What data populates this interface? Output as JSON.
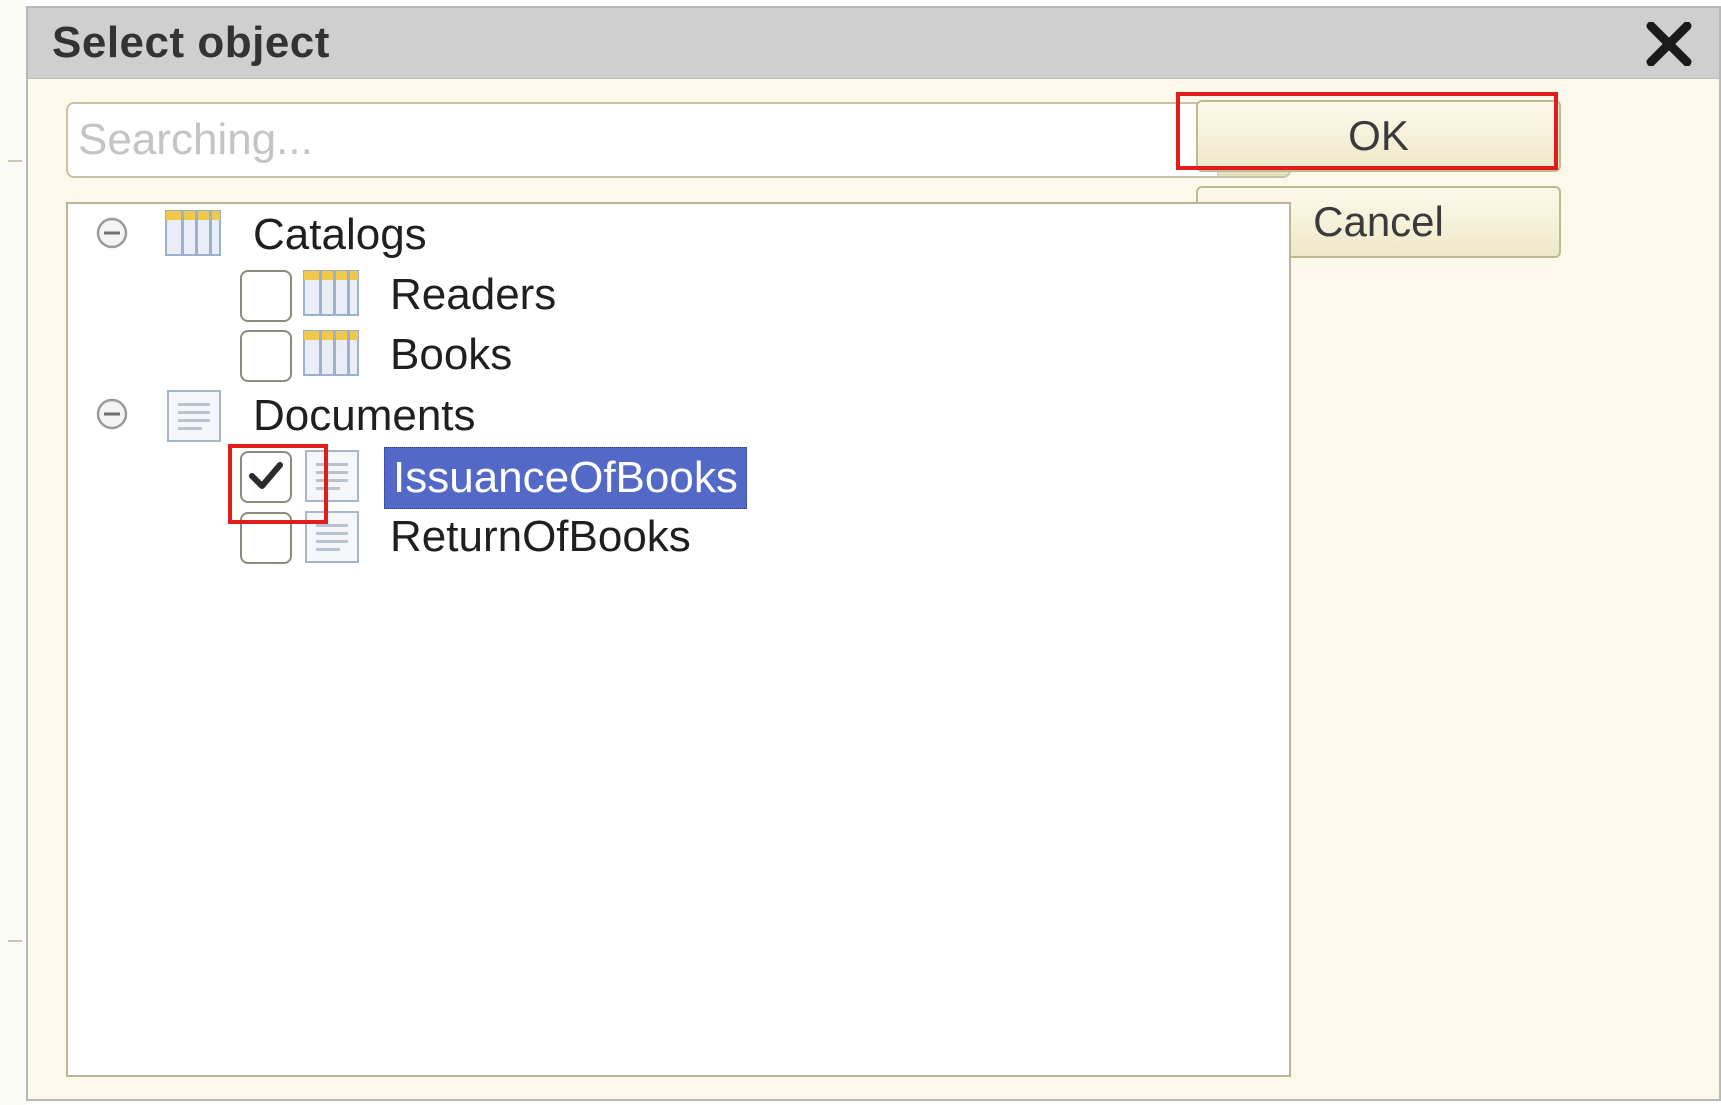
{
  "dialog": {
    "title": "Select object",
    "close_icon": "close-icon"
  },
  "search": {
    "value": "",
    "placeholder": "Searching...",
    "clear_icon": "clear-icon"
  },
  "buttons": {
    "ok_label": "OK",
    "cancel_label": "Cancel"
  },
  "tree": {
    "groups": [
      {
        "label": "Catalogs",
        "icon": "catalog-icon",
        "expanded": true,
        "items": [
          {
            "label": "Readers",
            "icon": "catalog-icon",
            "checked": false,
            "selected": false
          },
          {
            "label": "Books",
            "icon": "catalog-icon",
            "checked": false,
            "selected": false
          }
        ]
      },
      {
        "label": "Documents",
        "icon": "document-icon",
        "expanded": true,
        "items": [
          {
            "label": "IssuanceOfBooks",
            "icon": "document-icon",
            "checked": true,
            "selected": true
          },
          {
            "label": "ReturnOfBooks",
            "icon": "document-icon",
            "checked": false,
            "selected": false
          }
        ]
      }
    ]
  },
  "colors": {
    "selection": "#5468c8",
    "highlight": "#e21b1b",
    "titlebar": "#cfcfcf",
    "dialog_background": "#fcf9ea"
  }
}
